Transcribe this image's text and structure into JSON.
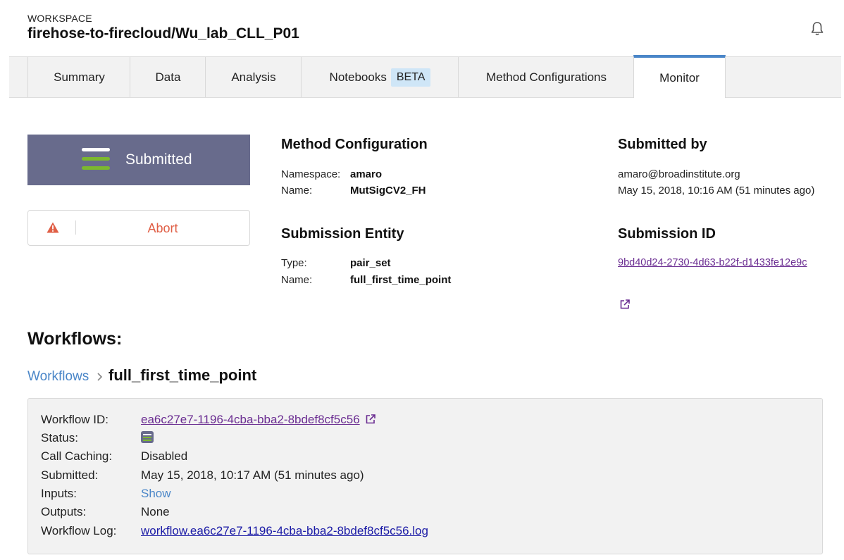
{
  "header": {
    "workspace_label": "WORKSPACE",
    "workspace_name": "firehose-to-firecloud/Wu_lab_CLL_P01",
    "notification_icon": "bell-icon"
  },
  "tabs": [
    {
      "label": "Summary"
    },
    {
      "label": "Data"
    },
    {
      "label": "Analysis"
    },
    {
      "label": "Notebooks",
      "badge": "BETA"
    },
    {
      "label": "Method Configurations"
    },
    {
      "label": "Monitor",
      "active": true
    }
  ],
  "status": {
    "label": "Submitted",
    "icon": "submitted-status-icon",
    "box_color": "#686b8c",
    "bar_colors": [
      "#ffffff",
      "#7cb82f",
      "#7cb82f"
    ]
  },
  "abort": {
    "label": "Abort",
    "icon": "warning-icon",
    "color": "#e05f46"
  },
  "method_configuration": {
    "heading": "Method Configuration",
    "namespace_label": "Namespace:",
    "namespace": "amaro",
    "name_label": "Name:",
    "name": "MutSigCV2_FH"
  },
  "submission_entity": {
    "heading": "Submission Entity",
    "type_label": "Type:",
    "type": "pair_set",
    "name_label": "Name:",
    "name": "full_first_time_point"
  },
  "submitted_by": {
    "heading": "Submitted by",
    "email": "amaro@broadinstitute.org",
    "date": "May 15, 2018, 10:16 AM (51 minutes ago)"
  },
  "submission_id": {
    "heading": "Submission ID",
    "value": "9bd40d24-2730-4d63-b22f-d1433fe12e9c",
    "icon": "external-link-icon"
  },
  "workflows": {
    "title": "Workflows:",
    "breadcrumb_root": "Workflows",
    "breadcrumb_current": "full_first_time_point",
    "details": {
      "workflow_id_label": "Workflow ID:",
      "workflow_id": "ea6c27e7-1196-4cba-bba2-8bdef8cf5c56",
      "status_label": "Status:",
      "call_caching_label": "Call Caching:",
      "call_caching": "Disabled",
      "submitted_label": "Submitted:",
      "submitted": "May 15, 2018, 10:17 AM (51 minutes ago)",
      "inputs_label": "Inputs:",
      "inputs_link": "Show",
      "outputs_label": "Outputs:",
      "outputs": "None",
      "log_label": "Workflow Log:",
      "log_file": "workflow.ea6c27e7-1196-4cba-bba2-8bdef8cf5c56.log"
    }
  },
  "colors": {
    "accent_blue": "#4a86c8",
    "link_purple": "#6a2c91",
    "link_navy": "#1a1aa6"
  }
}
